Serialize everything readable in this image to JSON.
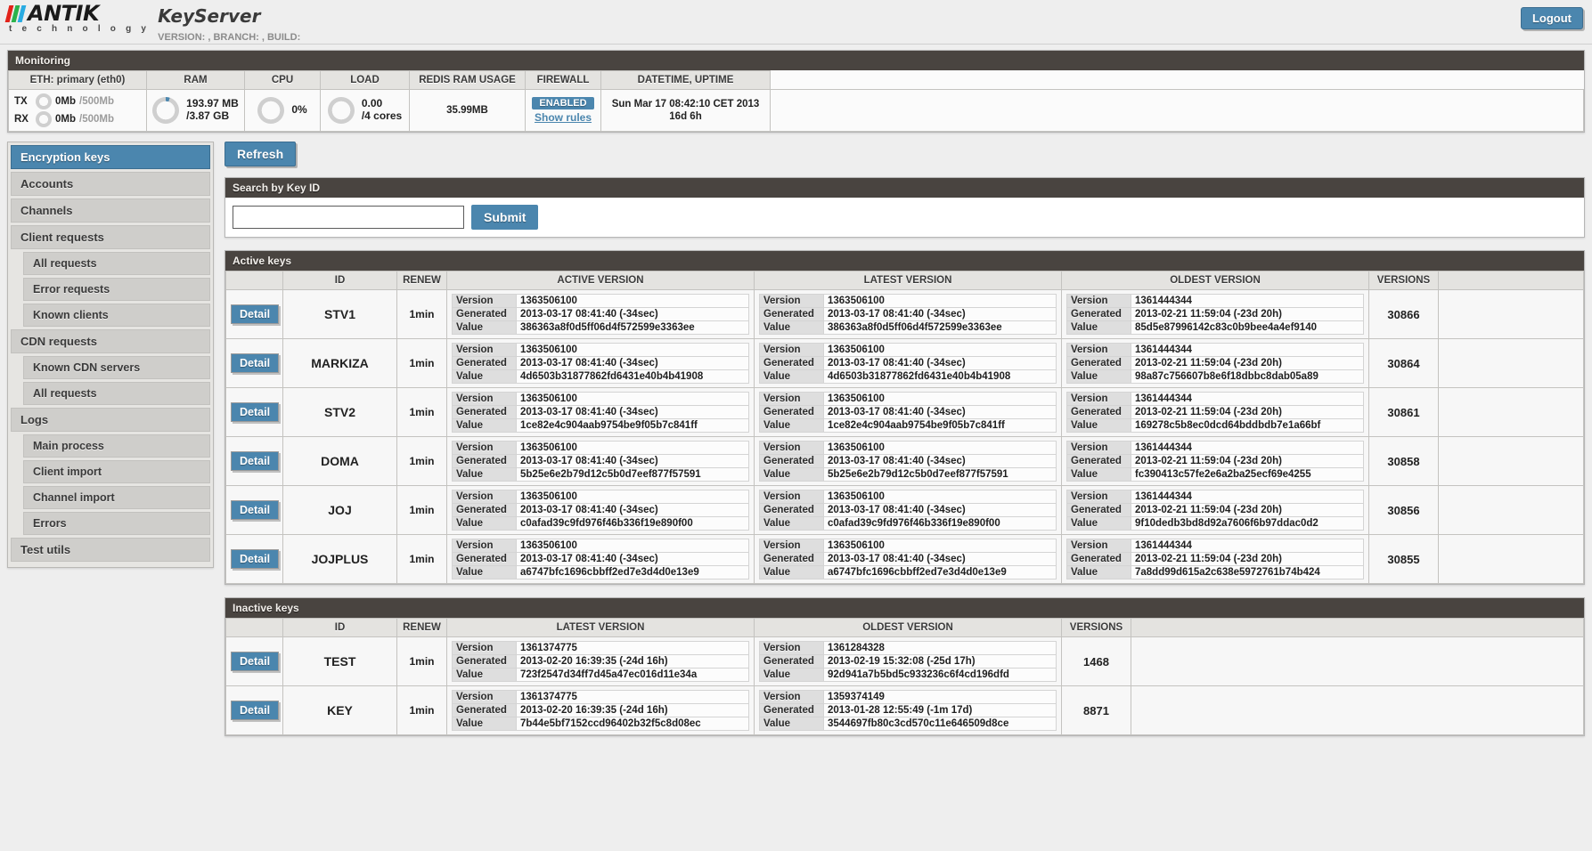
{
  "header": {
    "brand": "ANTIK",
    "brand_sub": "t e c h n o l o g y",
    "app_name": "KeyServer",
    "version_line": "VERSION: , BRANCH: , BUILD:",
    "logout_label": "Logout",
    "accent_color": "#4b86ae"
  },
  "monitoring": {
    "title": "Monitoring",
    "columns": [
      "ETH: primary (eth0)",
      "RAM",
      "CPU",
      "LOAD",
      "REDIS RAM USAGE",
      "FIREWALL",
      "DATETIME, UPTIME"
    ],
    "eth": {
      "tx_label": "TX",
      "tx_value": "0Mb",
      "tx_max": "/500Mb",
      "rx_label": "RX",
      "rx_value": "0Mb",
      "rx_max": "/500Mb"
    },
    "ram": {
      "used": "193.97 MB",
      "total": "/3.87 GB"
    },
    "cpu": {
      "percent": "0%"
    },
    "load": {
      "value": "0.00",
      "cores": "/4 cores"
    },
    "redis": {
      "usage": "35.99MB"
    },
    "firewall": {
      "status": "ENABLED",
      "link": "Show rules"
    },
    "datetime": {
      "now": "Sun Mar 17 08:42:10 CET 2013",
      "uptime": "16d 6h"
    }
  },
  "sidebar": {
    "items": [
      {
        "label": "Encryption keys",
        "sub": false,
        "active": true
      },
      {
        "label": "Accounts",
        "sub": false,
        "active": false
      },
      {
        "label": "Channels",
        "sub": false,
        "active": false
      },
      {
        "label": "Client requests",
        "sub": false,
        "active": false
      },
      {
        "label": "All requests",
        "sub": true,
        "active": false
      },
      {
        "label": "Error requests",
        "sub": true,
        "active": false
      },
      {
        "label": "Known clients",
        "sub": true,
        "active": false
      },
      {
        "label": "CDN requests",
        "sub": false,
        "active": false
      },
      {
        "label": "Known CDN servers",
        "sub": true,
        "active": false
      },
      {
        "label": "All requests",
        "sub": true,
        "active": false
      },
      {
        "label": "Logs",
        "sub": false,
        "active": false
      },
      {
        "label": "Main process",
        "sub": true,
        "active": false
      },
      {
        "label": "Client import",
        "sub": true,
        "active": false
      },
      {
        "label": "Channel import",
        "sub": true,
        "active": false
      },
      {
        "label": "Errors",
        "sub": true,
        "active": false
      },
      {
        "label": "Test utils",
        "sub": false,
        "active": false
      }
    ]
  },
  "main": {
    "refresh_label": "Refresh",
    "search": {
      "title": "Search by Key ID",
      "input_value": "",
      "placeholder": "",
      "submit_label": "Submit"
    },
    "version_field_labels": {
      "version": "Version",
      "generated": "Generated",
      "value": "Value"
    },
    "detail_label": "Detail",
    "active": {
      "title": "Active keys",
      "columns": [
        "",
        "ID",
        "RENEW",
        "ACTIVE VERSION",
        "LATEST VERSION",
        "OLDEST VERSION",
        "VERSIONS",
        ""
      ],
      "rows": [
        {
          "id": "STV1",
          "renew": "1min",
          "versions": "30866",
          "active": {
            "version": "1363506100",
            "generated": "2013-03-17 08:41:40 (-34sec)",
            "value": "386363a8f0d5ff06d4f572599e3363ee"
          },
          "latest": {
            "version": "1363506100",
            "generated": "2013-03-17 08:41:40 (-34sec)",
            "value": "386363a8f0d5ff06d4f572599e3363ee"
          },
          "oldest": {
            "version": "1361444344",
            "generated": "2013-02-21 11:59:04 (-23d 20h)",
            "value": "85d5e87996142c83c0b9bee4a4ef9140"
          }
        },
        {
          "id": "MARKIZA",
          "renew": "1min",
          "versions": "30864",
          "active": {
            "version": "1363506100",
            "generated": "2013-03-17 08:41:40 (-34sec)",
            "value": "4d6503b31877862fd6431e40b4b41908"
          },
          "latest": {
            "version": "1363506100",
            "generated": "2013-03-17 08:41:40 (-34sec)",
            "value": "4d6503b31877862fd6431e40b4b41908"
          },
          "oldest": {
            "version": "1361444344",
            "generated": "2013-02-21 11:59:04 (-23d 20h)",
            "value": "98a87c756607b8e6f18dbbc8dab05a89"
          }
        },
        {
          "id": "STV2",
          "renew": "1min",
          "versions": "30861",
          "active": {
            "version": "1363506100",
            "generated": "2013-03-17 08:41:40 (-34sec)",
            "value": "1ce82e4c904aab9754be9f05b7c841ff"
          },
          "latest": {
            "version": "1363506100",
            "generated": "2013-03-17 08:41:40 (-34sec)",
            "value": "1ce82e4c904aab9754be9f05b7c841ff"
          },
          "oldest": {
            "version": "1361444344",
            "generated": "2013-02-21 11:59:04 (-23d 20h)",
            "value": "169278c5b8ec0dcd64bddbdb7e1a66bf"
          }
        },
        {
          "id": "DOMA",
          "renew": "1min",
          "versions": "30858",
          "active": {
            "version": "1363506100",
            "generated": "2013-03-17 08:41:40 (-34sec)",
            "value": "5b25e6e2b79d12c5b0d7eef877f57591"
          },
          "latest": {
            "version": "1363506100",
            "generated": "2013-03-17 08:41:40 (-34sec)",
            "value": "5b25e6e2b79d12c5b0d7eef877f57591"
          },
          "oldest": {
            "version": "1361444344",
            "generated": "2013-02-21 11:59:04 (-23d 20h)",
            "value": "fc390413c57fe2e6a2ba25ecf69e4255"
          }
        },
        {
          "id": "JOJ",
          "renew": "1min",
          "versions": "30856",
          "active": {
            "version": "1363506100",
            "generated": "2013-03-17 08:41:40 (-34sec)",
            "value": "c0afad39c9fd976f46b336f19e890f00"
          },
          "latest": {
            "version": "1363506100",
            "generated": "2013-03-17 08:41:40 (-34sec)",
            "value": "c0afad39c9fd976f46b336f19e890f00"
          },
          "oldest": {
            "version": "1361444344",
            "generated": "2013-02-21 11:59:04 (-23d 20h)",
            "value": "9f10dedb3bd8d92a7606f6b97ddac0d2"
          }
        },
        {
          "id": "JOJPLUS",
          "renew": "1min",
          "versions": "30855",
          "active": {
            "version": "1363506100",
            "generated": "2013-03-17 08:41:40 (-34sec)",
            "value": "a6747bfc1696cbbff2ed7e3d4d0e13e9"
          },
          "latest": {
            "version": "1363506100",
            "generated": "2013-03-17 08:41:40 (-34sec)",
            "value": "a6747bfc1696cbbff2ed7e3d4d0e13e9"
          },
          "oldest": {
            "version": "1361444344",
            "generated": "2013-02-21 11:59:04 (-23d 20h)",
            "value": "7a8dd99d615a2c638e5972761b74b424"
          }
        }
      ]
    },
    "inactive": {
      "title": "Inactive keys",
      "columns": [
        "",
        "ID",
        "RENEW",
        "LATEST VERSION",
        "OLDEST VERSION",
        "VERSIONS",
        ""
      ],
      "rows": [
        {
          "id": "TEST",
          "renew": "1min",
          "versions": "1468",
          "latest": {
            "version": "1361374775",
            "generated": "2013-02-20 16:39:35 (-24d 16h)",
            "value": "723f2547d34ff7d45a47ec016d11e34a"
          },
          "oldest": {
            "version": "1361284328",
            "generated": "2013-02-19 15:32:08 (-25d 17h)",
            "value": "92d941a7b5bd5c933236c6f4cd196dfd"
          }
        },
        {
          "id": "KEY",
          "renew": "1min",
          "versions": "8871",
          "latest": {
            "version": "1361374775",
            "generated": "2013-02-20 16:39:35 (-24d 16h)",
            "value": "7b44e5bf7152ccd96402b32f5c8d08ec"
          },
          "oldest": {
            "version": "1359374149",
            "generated": "2013-01-28 12:55:49 (-1m 17d)",
            "value": "3544697fb80c3cd570c11e646509d8ce"
          }
        }
      ]
    }
  }
}
